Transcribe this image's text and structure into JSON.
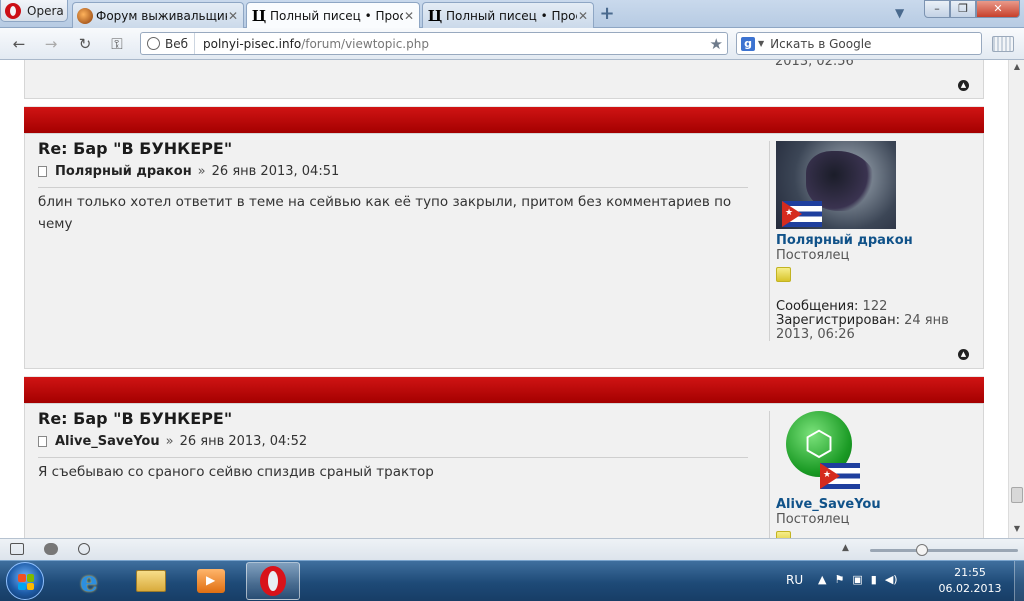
{
  "browser": {
    "menu_label": "Opera",
    "tabs": [
      {
        "title": "Форум выживальщик...",
        "icon": "globe-icon"
      },
      {
        "title": "Полный писец • Прос...",
        "icon": "pi-icon"
      },
      {
        "title": "Полный писец • Прос...",
        "icon": "pi-icon"
      }
    ],
    "address": {
      "badge": "Веб",
      "url_host": "polnyi-pisec.info",
      "url_path": "/forum/viewtopic.php"
    },
    "search": {
      "placeholder": "Искать в Google",
      "engine": "g"
    }
  },
  "partial_post": {
    "reg_date_fragment": "2013, 02:56"
  },
  "posts": [
    {
      "title": "Re: Бар \"В БУНКЕРЕ\"",
      "author": "Полярный дракон",
      "date": "26 янв 2013, 04:51",
      "text": "блин только хотел ответит в теме на сейвью как её тупо закрыли, притом без комментариев по чему",
      "profile": {
        "name": "Полярный дракон",
        "rank": "Постоялец",
        "messages_label": "Сообщения:",
        "messages": "122",
        "registered_label": "Зарегистрирован:",
        "registered": "24 янв 2013, 06:26"
      }
    },
    {
      "title": "Re: Бар \"В БУНКЕРЕ\"",
      "author": "Alive_SaveYou",
      "date": "26 янв 2013, 04:52",
      "text": "Я съебываю со сраного сейвю спиздив сраный трактор",
      "profile": {
        "name": "Alive_SaveYou",
        "rank": "Постоялец"
      }
    }
  ],
  "meta_separator": "»",
  "taskbar": {
    "language": "RU",
    "time": "21:55",
    "date": "06.02.2013"
  },
  "colors": {
    "post_header_red": "#c00000",
    "username_blue": "#105289"
  }
}
